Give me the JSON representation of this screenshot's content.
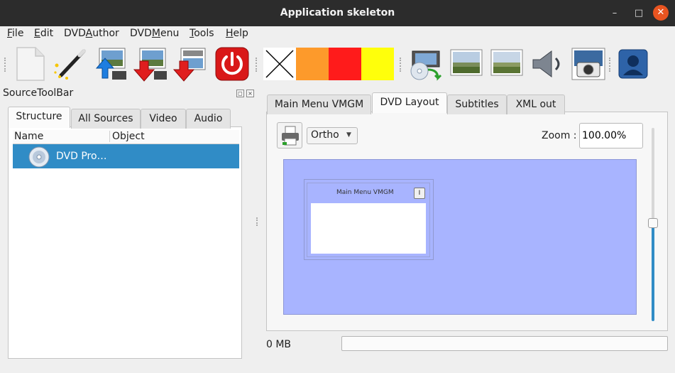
{
  "window": {
    "title": "Application skeleton",
    "minimize_icon": "minimize-icon",
    "maximize_icon": "maximize-icon",
    "close_icon": "close-icon"
  },
  "menubar": {
    "items": [
      {
        "mnemonic": "F",
        "rest": "ile"
      },
      {
        "mnemonic": "E",
        "rest": "dit"
      },
      {
        "prefix": "DVD",
        "mnemonic": "A",
        "rest": "uthor"
      },
      {
        "prefix": "DVD",
        "mnemonic": "M",
        "rest": "enu"
      },
      {
        "mnemonic": "T",
        "rest": "ools"
      },
      {
        "mnemonic": "H",
        "rest": "elp"
      }
    ]
  },
  "toolbar": {
    "icons": [
      "new-file-icon",
      "wizard-icon",
      "import-icon",
      "export-icon",
      "export-menu-icon",
      "quit-icon",
      "clear-color-icon",
      "dvd-preview-icon",
      "landscape-image-icon",
      "landscape-image-icon",
      "speaker-icon",
      "camera-icon",
      "user-icon"
    ],
    "colors": {
      "orange": "#fd9a2b",
      "red": "#ff1b1b",
      "yellow": "#ffff0b"
    }
  },
  "dock": {
    "title": "SourceToolBar",
    "tabs": [
      "Structure",
      "All Sources",
      "Video",
      "Audio"
    ],
    "tree": {
      "columns": [
        "Name",
        "Object"
      ],
      "rows": [
        {
          "name": "DVD Pro…",
          "object": "",
          "icon": "dvd-disc-icon"
        }
      ]
    }
  },
  "main": {
    "tabs": [
      "Main Menu VMGM",
      "DVD Layout",
      "Subtitles",
      "XML out"
    ],
    "active_tab": "DVD Layout",
    "projection": "Ortho",
    "zoom_label": "Zoom :",
    "zoom_value": "100.00%",
    "canvas_color": "#a8b4ff",
    "menu_node": {
      "label": "Main Menu VMGM",
      "badge": "I"
    },
    "slider_level_percent": 50,
    "size_label": "0 MB",
    "progress_percent": 0
  },
  "colors": {
    "accent": "#308cc6",
    "close_button": "#e95420"
  }
}
